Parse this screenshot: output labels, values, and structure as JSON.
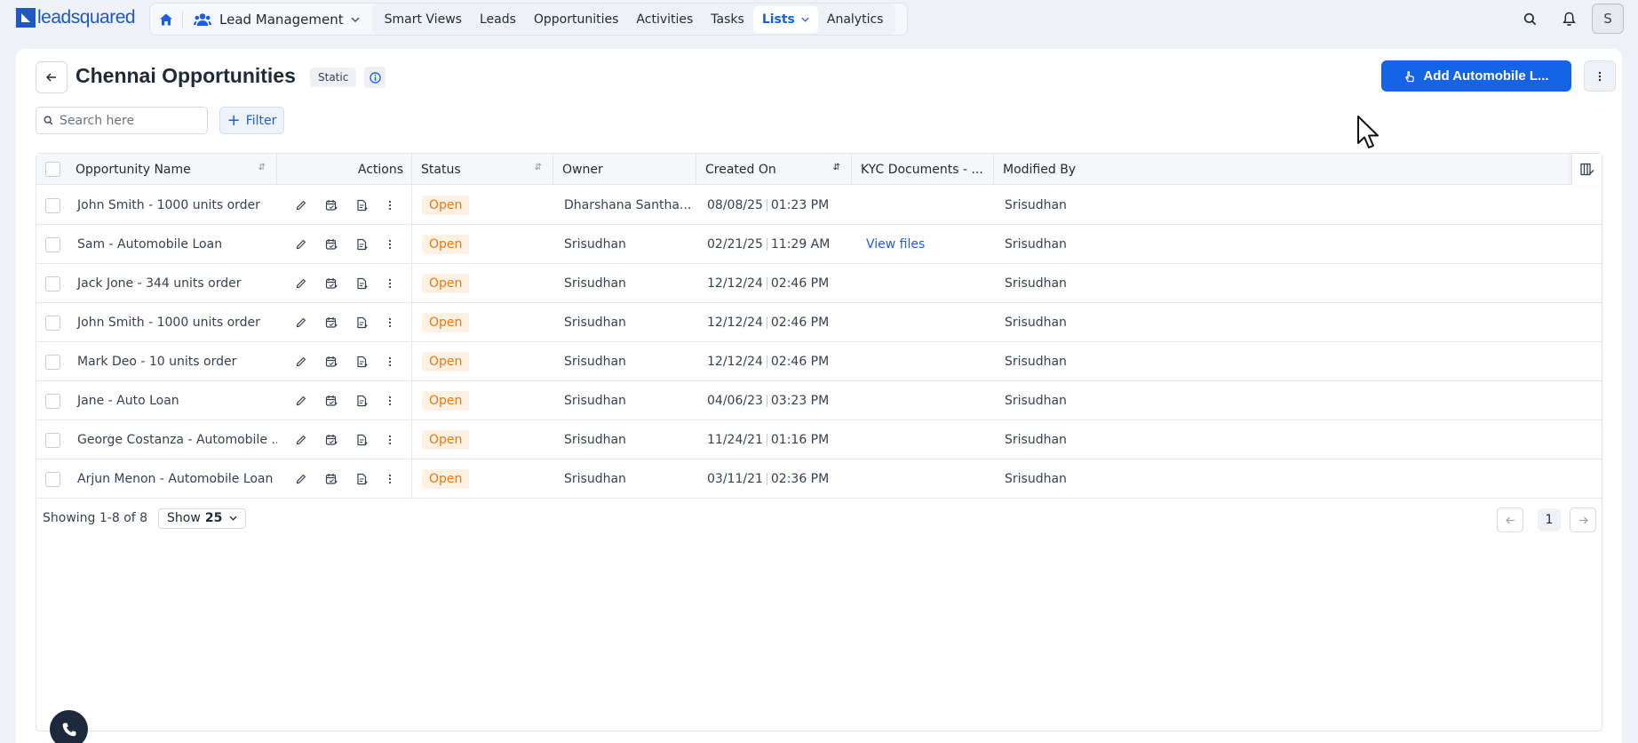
{
  "brand": {
    "logo_text": "leadsquared"
  },
  "nav": {
    "module": "Lead Management",
    "tabs": [
      {
        "label": "Smart Views"
      },
      {
        "label": "Leads"
      },
      {
        "label": "Opportunities"
      },
      {
        "label": "Activities"
      },
      {
        "label": "Tasks"
      },
      {
        "label": "Lists"
      },
      {
        "label": "Analytics"
      }
    ],
    "active_tab": "Lists",
    "avatar_initial": "S"
  },
  "page": {
    "title": "Chennai Opportunities",
    "badge": "Static",
    "primary_action": "Add Automobile L..."
  },
  "toolbar": {
    "search_placeholder": "Search here",
    "filter_label": "Filter"
  },
  "table": {
    "columns": {
      "name": "Opportunity Name",
      "actions": "Actions",
      "status": "Status",
      "owner": "Owner",
      "created": "Created On",
      "kyc": "KYC Documents - ...",
      "modified": "Modified By"
    },
    "rows": [
      {
        "name": "John Smith - 1000 units order",
        "status": "Open",
        "owner": "Dharshana Santha...",
        "date": "08/08/25",
        "time": "01:23 PM",
        "kyc": "",
        "modified": "Srisudhan"
      },
      {
        "name": "Sam - Automobile Loan",
        "status": "Open",
        "owner": "Srisudhan",
        "date": "02/21/25",
        "time": "11:29 AM",
        "kyc": "View files",
        "modified": "Srisudhan"
      },
      {
        "name": "Jack Jone - 344 units order",
        "status": "Open",
        "owner": "Srisudhan",
        "date": "12/12/24",
        "time": "02:46 PM",
        "kyc": "",
        "modified": "Srisudhan"
      },
      {
        "name": "John Smith - 1000 units order",
        "status": "Open",
        "owner": "Srisudhan",
        "date": "12/12/24",
        "time": "02:46 PM",
        "kyc": "",
        "modified": "Srisudhan"
      },
      {
        "name": "Mark Deo - 10 units order",
        "status": "Open",
        "owner": "Srisudhan",
        "date": "12/12/24",
        "time": "02:46 PM",
        "kyc": "",
        "modified": "Srisudhan"
      },
      {
        "name": "Jane - Auto Loan",
        "status": "Open",
        "owner": "Srisudhan",
        "date": "04/06/23",
        "time": "03:23 PM",
        "kyc": "",
        "modified": "Srisudhan"
      },
      {
        "name": "George Costanza - Automobile ...",
        "status": "Open",
        "owner": "Srisudhan",
        "date": "11/24/21",
        "time": "01:16 PM",
        "kyc": "",
        "modified": "Srisudhan"
      },
      {
        "name": "Arjun Menon - Automobile Loan",
        "status": "Open",
        "owner": "Srisudhan",
        "date": "03/11/21",
        "time": "02:36 PM",
        "kyc": "",
        "modified": "Srisudhan"
      }
    ]
  },
  "footer": {
    "showing": "Showing 1-8 of 8",
    "show_prefix": "Show",
    "page_size": "25",
    "current_page": "1"
  },
  "colors": {
    "accent": "#1563e6",
    "status_open_text": "#ea7a12",
    "status_open_bg": "#fdf1e4"
  }
}
